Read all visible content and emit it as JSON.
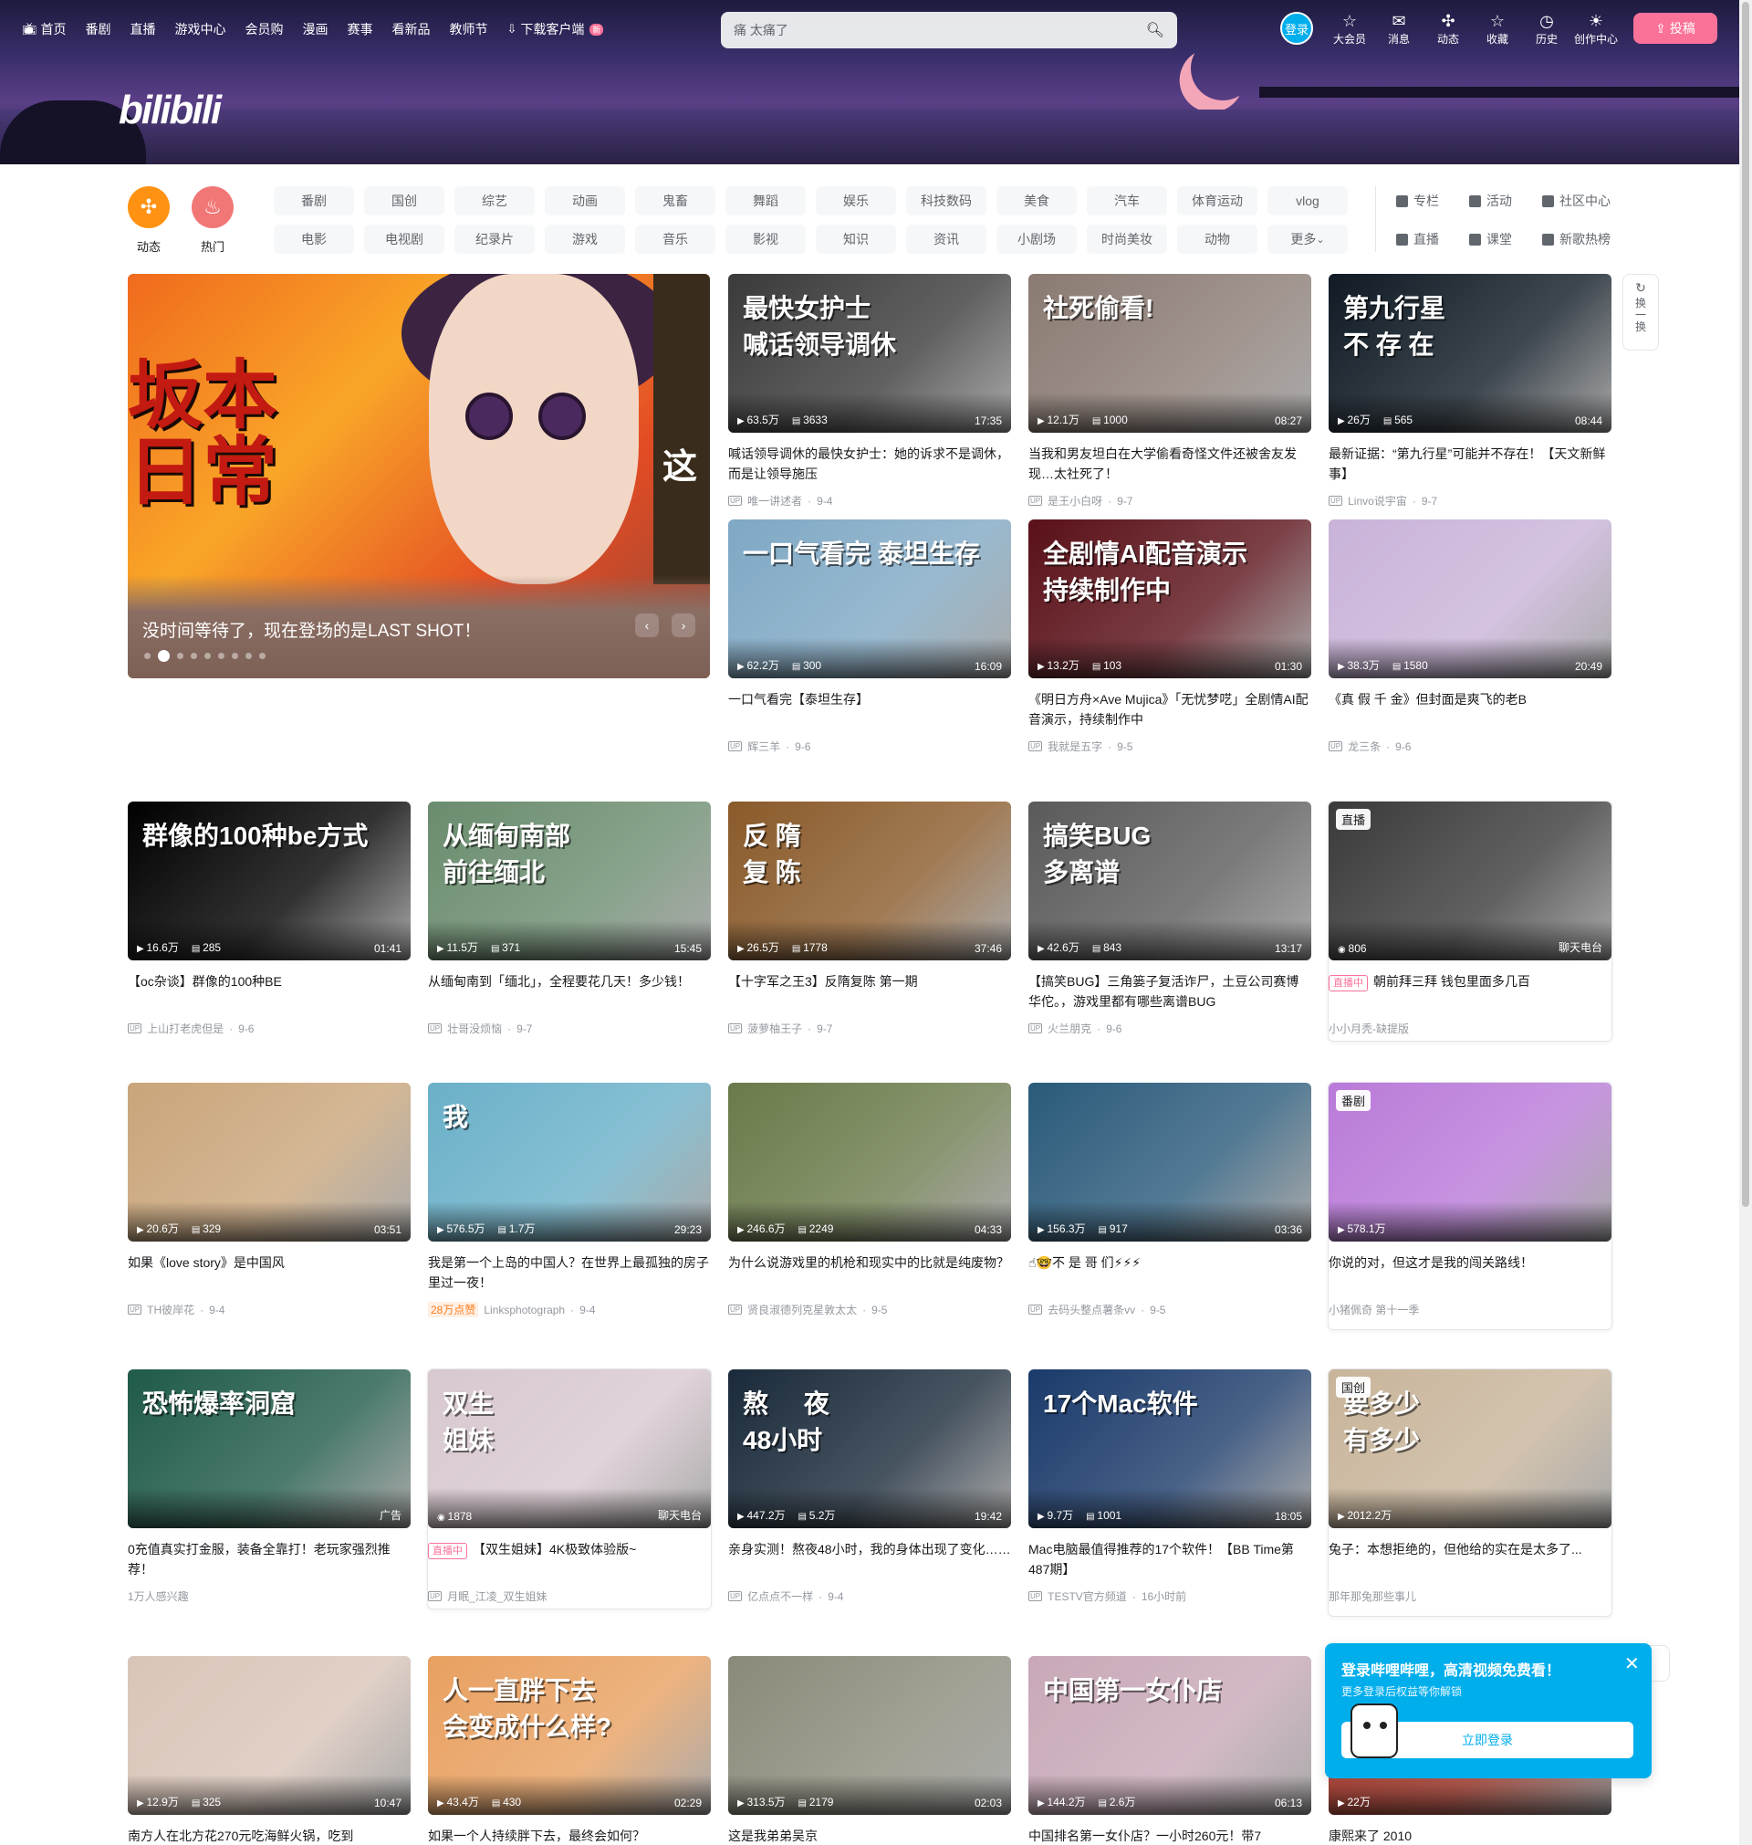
{
  "header": {
    "nav": [
      {
        "label": "首页",
        "icon": "tv-icon"
      },
      {
        "label": "番剧"
      },
      {
        "label": "直播"
      },
      {
        "label": "游戏中心"
      },
      {
        "label": "会员购"
      },
      {
        "label": "漫画"
      },
      {
        "label": "赛事"
      },
      {
        "label": "看新品"
      },
      {
        "label": "教师节"
      },
      {
        "label": "下载客户端",
        "icon": "download-icon",
        "badge": "新"
      }
    ],
    "search_value": "痛 太痛了",
    "login_label": "登录",
    "right_nav": [
      {
        "label": "大会员",
        "icon": "vip-icon"
      },
      {
        "label": "消息",
        "icon": "message-icon"
      },
      {
        "label": "动态",
        "icon": "dynamic-icon"
      },
      {
        "label": "收藏",
        "icon": "star-icon"
      },
      {
        "label": "历史",
        "icon": "clock-icon"
      },
      {
        "label": "创作中心",
        "icon": "bulb-icon"
      }
    ],
    "upload_label": "投稿",
    "logo_text": "bilibili"
  },
  "quick": [
    {
      "label": "动态",
      "color": "#ff9212"
    },
    {
      "label": "热门",
      "color": "#f07775"
    }
  ],
  "channels_row1": [
    "番剧",
    "国创",
    "综艺",
    "动画",
    "鬼畜",
    "舞蹈",
    "娱乐",
    "科技数码",
    "美食",
    "汽车",
    "体育运动",
    "vlog"
  ],
  "channels_row2": [
    "电影",
    "电视剧",
    "纪录片",
    "游戏",
    "音乐",
    "影视",
    "知识",
    "资讯",
    "小剧场",
    "时尚美妆",
    "动物",
    "更多"
  ],
  "side_links": [
    [
      "专栏",
      "活动",
      "社区中心"
    ],
    [
      "直播",
      "课堂",
      "新歌热榜"
    ]
  ],
  "banner": {
    "big_text": "坂本\n日常",
    "title": "没时间等待了，现在登场的是LAST SHOT！",
    "side_text": "这"
  },
  "refresh_label": "换一换",
  "cards": [
    {
      "title": "喊话领导调休的最快女护士：她的诉求不是调休，而是让领导施压",
      "views": "63.5万",
      "danmaku": "3633",
      "duration": "17:35",
      "author": "唯一讲述者",
      "date": "9-4",
      "overlay": "最快女护士\n喊话领导调休",
      "bg": "#3a3a3a"
    },
    {
      "title": "当我和男友坦白在大学偷看奇怪文件还被舍友发现…太社死了！",
      "views": "12.1万",
      "danmaku": "1000",
      "duration": "08:27",
      "author": "是王小白呀",
      "date": "9-7",
      "overlay": "社死偷看!",
      "bg": "#8a7a72"
    },
    {
      "title": "最新证据：“第九行星”可能并不存在！【天文新鲜事】",
      "views": "26万",
      "danmaku": "565",
      "duration": "08:44",
      "author": "Linvo说宇宙",
      "date": "9-7",
      "overlay": "第九行星\n不 存 在",
      "bg": "#0f1a24"
    },
    {
      "title": "一口气看完【泰坦生存】",
      "views": "62.2万",
      "danmaku": "300",
      "duration": "16:09",
      "author": "辉三羊",
      "date": "9-6",
      "overlay": "一口气看完 泰坦生存",
      "bg": "#7fa8c4"
    },
    {
      "title": "《明日方舟×Ave Mujica》「无忧梦呓」全剧情AI配音演示，持续制作中",
      "views": "13.2万",
      "danmaku": "103",
      "duration": "01:30",
      "author": "我就是五字",
      "date": "9-5",
      "overlay": "全剧情AI配音演示\n持续制作中",
      "bg": "#5a1018"
    },
    {
      "title": "《真 假 千 金》但封面是爽飞的老B",
      "views": "38.3万",
      "danmaku": "1580",
      "duration": "20:49",
      "author": "龙三条",
      "date": "9-6",
      "overlay": "",
      "bg": "#c9b3d9"
    },
    {
      "title": "【oc杂谈】群像的100种BE",
      "views": "16.6万",
      "danmaku": "285",
      "duration": "01:41",
      "author": "上山打老虎但是",
      "date": "9-6",
      "overlay": "群像的100种be方式",
      "bg": "#000000"
    },
    {
      "title": "从缅甸南到「缅北」，全程要花几天！多少钱！",
      "views": "11.5万",
      "danmaku": "371",
      "duration": "15:45",
      "author": "壮哥没烦恼",
      "date": "9-7",
      "overlay": "从缅甸南部\n前往缅北",
      "bg": "#6a8c6e"
    },
    {
      "title": "【十字军之王3】反隋复陈 第一期",
      "views": "26.5万",
      "danmaku": "1778",
      "duration": "37:46",
      "author": "菠萝柚王子",
      "date": "9-7",
      "overlay": "反 隋\n复 陈",
      "bg": "#8a5a2a"
    },
    {
      "title": "【搞笑BUG】三角篓子复活诈尸，土豆公司赛博华佗。，游戏里都有哪些离谱BUG",
      "views": "42.6万",
      "danmaku": "843",
      "duration": "13:17",
      "author": "火兰朋克",
      "date": "9-6",
      "overlay": "搞笑BUG\n多离谱",
      "bg": "#5a5a5a"
    },
    {
      "title": "朝前拜三拜 钱包里面多几百",
      "views": "806",
      "danmaku": "",
      "duration": "聊天电台",
      "author": "小小月秃-缺提版",
      "date": "",
      "overlay": "",
      "bg": "#3a3a3a",
      "tag": "直播",
      "live": true
    },
    {
      "title": "如果《love story》是中国风",
      "views": "20.6万",
      "danmaku": "329",
      "duration": "03:51",
      "author": "TH彼岸花",
      "date": "9-4",
      "overlay": "",
      "bg": "#c9a57a"
    },
    {
      "title": "我是第一个上岛的中国人？在世界上最孤独的房子里过一夜！",
      "views": "576.5万",
      "danmaku": "1.7万",
      "duration": "29:23",
      "author": "Linksphotograph",
      "date": "9-4",
      "overlay": "我",
      "bg": "#6ab0c8",
      "hot": "28万点赞"
    },
    {
      "title": "为什么说游戏里的机枪和现实中的比就是纯废物？",
      "views": "246.6万",
      "danmaku": "2249",
      "duration": "04:33",
      "author": "贤良淑德列克星敦太太",
      "date": "9-5",
      "overlay": "",
      "bg": "#6a7a4a"
    },
    {
      "title": "☝🤓不 是 哥 们⚡⚡⚡",
      "views": "156.3万",
      "danmaku": "917",
      "duration": "03:36",
      "author": "去码头整点薯条vv",
      "date": "9-5",
      "overlay": "",
      "bg": "#2a5a7a"
    },
    {
      "title": "你说的对，但这才是我的闯关路线！",
      "views": "578.1万",
      "danmaku": "",
      "duration": "",
      "author": "小猪佩奇 第十一季",
      "date": "",
      "overlay": "",
      "bg": "#b97ad9",
      "tag": "番剧"
    },
    {
      "title": "0充值真实打金服，装备全靠打！老玩家强烈推荐！",
      "views": "",
      "danmaku": "",
      "duration": "广告",
      "author": "1万人感兴趣",
      "date": "",
      "overlay": "恐怖爆率洞窟",
      "bg": "#1f5a4a",
      "ad": true
    },
    {
      "title": "【双生姐妹】4K极致体验版~",
      "views": "1878",
      "danmaku": "",
      "duration": "聊天电台",
      "author": "月眠_江凌_双生姐妹",
      "date": "",
      "overlay": "双生\n姐妹",
      "bg": "#d8c8d0",
      "live": true
    },
    {
      "title": "亲身实测！熬夜48小时，我的身体出现了变化……",
      "views": "447.2万",
      "danmaku": "5.2万",
      "duration": "19:42",
      "author": "亿点点不一样",
      "date": "9-4",
      "overlay": "熬     夜\n48小时",
      "bg": "#1a2a3a"
    },
    {
      "title": "Mac电脑最值得推荐的17个软件！【BB Time第487期】",
      "views": "9.7万",
      "danmaku": "1001",
      "duration": "18:05",
      "author": "TESTV官方频道",
      "date": "16小时前",
      "overlay": "17个Mac软件",
      "bg": "#1a3a6a"
    },
    {
      "title": "兔子：本想拒绝的，但他给的实在是太多了...",
      "views": "2012.2万",
      "danmaku": "",
      "duration": "",
      "author": "那年那兔那些事儿",
      "date": "",
      "overlay": "要多少\n有多少",
      "bg": "#c8b49a",
      "tag": "国创"
    },
    {
      "title": "南方人在北方花270元吃海鲜火锅，吃到",
      "views": "12.9万",
      "danmaku": "325",
      "duration": "10:47",
      "author": "",
      "date": "",
      "overlay": "",
      "bg": "#d9c4b8"
    },
    {
      "title": "如果一个人持续胖下去，最终会如何？",
      "views": "43.4万",
      "danmaku": "430",
      "duration": "02:29",
      "author": "",
      "date": "",
      "overlay": "人一直胖下去\n会变成什么样?",
      "bg": "#e8a060"
    },
    {
      "title": "这是我弟弟吴京",
      "views": "313.5万",
      "danmaku": "2179",
      "duration": "02:03",
      "author": "",
      "date": "",
      "overlay": "",
      "bg": "#8a8a7a"
    },
    {
      "title": "中国排名第一女仆店？一小时260元！带7",
      "views": "144.2万",
      "danmaku": "2.6万",
      "duration": "06:13",
      "author": "",
      "date": "",
      "overlay": "中国第一女仆店",
      "bg": "#c8a8b8"
    },
    {
      "title": "康熙来了 2010",
      "views": "22万",
      "danmaku": "",
      "duration": "",
      "author": "",
      "date": "",
      "overlay": "",
      "bg": "#c04030"
    }
  ],
  "popup": {
    "title": "登录哔哩哔哩，高清视频免费看！",
    "subtitle": "更多登录后权益等你解锁",
    "button": "立即登录"
  }
}
